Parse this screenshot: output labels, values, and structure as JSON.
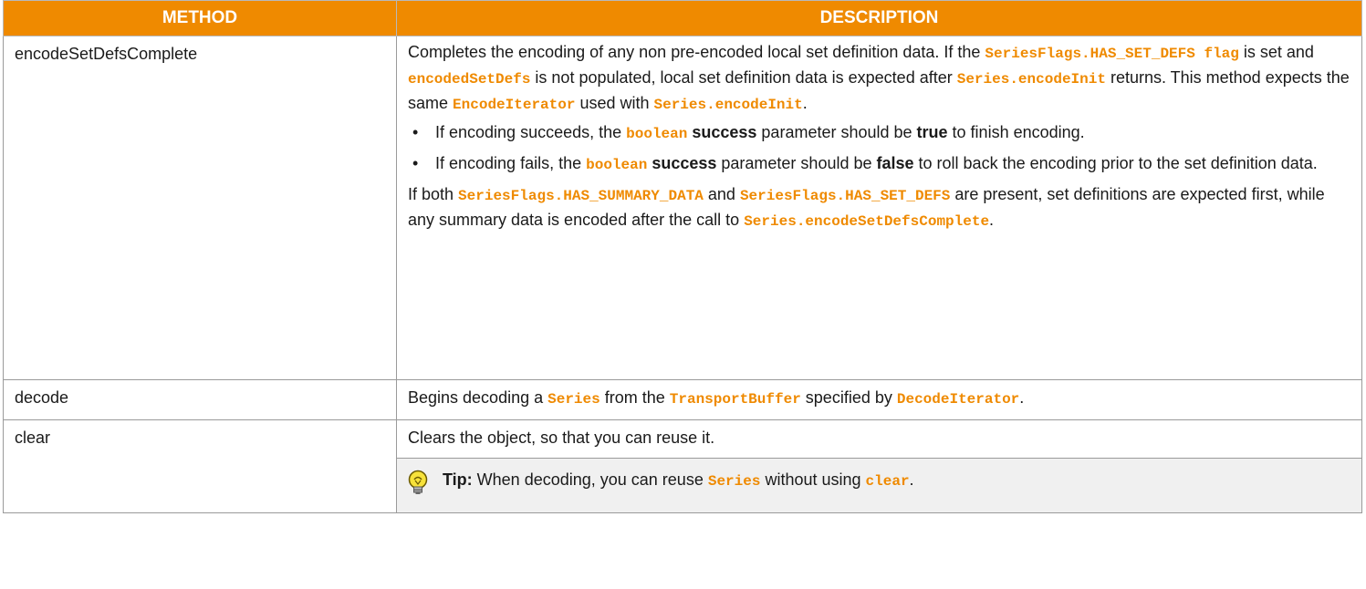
{
  "table": {
    "headers": {
      "method": "METHOD",
      "description": "DESCRIPTION"
    },
    "row1": {
      "method": "encodeSetDefsComplete",
      "p1": [
        {
          "t": "Completes the encoding of any non pre-encoded local set definition data. If the "
        },
        {
          "c": "SeriesFlags.HAS_SET_DEFS flag"
        },
        {
          "t": " is set and "
        },
        {
          "c": "encodedSetDefs"
        },
        {
          "t": " is not populated, local set definition data is expected after "
        },
        {
          "c": "Series.encodeInit"
        },
        {
          "t": " returns. This method expects the same "
        },
        {
          "c": "EncodeIterator"
        },
        {
          "t": " used with "
        },
        {
          "c": "Series.encodeInit"
        },
        {
          "t": "."
        }
      ],
      "bullet1": [
        {
          "t": "If encoding succeeds, the "
        },
        {
          "c": "boolean"
        },
        {
          "b": " success"
        },
        {
          "t": " parameter should be "
        },
        {
          "b": "true"
        },
        {
          "t": " to finish encoding."
        }
      ],
      "bullet2": [
        {
          "t": "If encoding fails, the "
        },
        {
          "c": "boolean"
        },
        {
          "b": " success"
        },
        {
          "t": " parameter should be "
        },
        {
          "b": "false"
        },
        {
          "t": " to roll back the encoding prior to the set definition data."
        }
      ],
      "p2": [
        {
          "t": "If both "
        },
        {
          "c": "SeriesFlags.HAS_SUMMARY_DATA"
        },
        {
          "t": " and "
        },
        {
          "c": "SeriesFlags.HAS_SET_DEFS"
        },
        {
          "t": " are present, set definitions are expected first, while any summary data is encoded after the call to "
        },
        {
          "c": "Series.encodeSetDefsComplete"
        },
        {
          "t": "."
        }
      ]
    },
    "row2": {
      "method": "decode",
      "desc": [
        {
          "t": "Begins decoding a "
        },
        {
          "c": "Series"
        },
        {
          "t": " from the "
        },
        {
          "c": "TransportBuffer"
        },
        {
          "t": " specified by "
        },
        {
          "c": "DecodeIterator"
        },
        {
          "t": "."
        }
      ]
    },
    "row3": {
      "method": "clear",
      "desc": [
        {
          "t": "Clears the object, so that you can reuse it."
        }
      ],
      "tip": [
        {
          "b": "Tip:"
        },
        {
          "t": " When decoding, you can reuse "
        },
        {
          "c": "Series"
        },
        {
          "t": " without using "
        },
        {
          "c": "clear"
        },
        {
          "t": "."
        }
      ]
    }
  },
  "icons": {
    "bullet": "•",
    "tip": "lightbulb-icon"
  },
  "colors": {
    "header": "#ef8a00",
    "code": "#ef8a00",
    "tip_bg": "#f0f0f0"
  }
}
